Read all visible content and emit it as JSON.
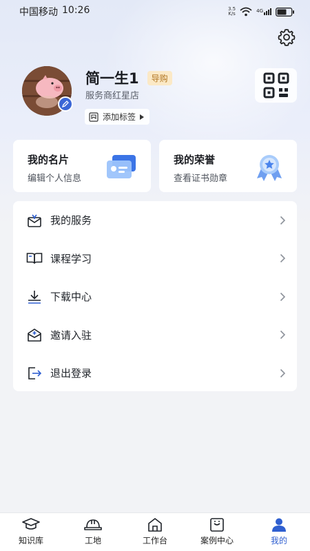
{
  "status_bar": {
    "carrier": "中国移动",
    "time": "10:26",
    "network_speed": "3.5",
    "speed_unit": "K/s",
    "signal_type": "4G"
  },
  "header": {
    "settings_icon": "gear-icon",
    "user_name": "简一生1",
    "role_badge": "导购",
    "store_name": "服务商红星店",
    "add_tag_label": "添加标签",
    "qr_icon": "qr-code-icon"
  },
  "cards": [
    {
      "title": "我的名片",
      "subtitle": "编辑个人信息",
      "icon": "business-card-icon"
    },
    {
      "title": "我的荣誉",
      "subtitle": "查看证书勋章",
      "icon": "medal-icon"
    }
  ],
  "menu": [
    {
      "label": "我的服务",
      "icon": "service-envelope-icon"
    },
    {
      "label": "课程学习",
      "icon": "book-icon"
    },
    {
      "label": "下载中心",
      "icon": "download-icon"
    },
    {
      "label": "邀请入驻",
      "icon": "invite-icon"
    },
    {
      "label": "退出登录",
      "icon": "logout-icon"
    }
  ],
  "tabbar": [
    {
      "label": "知识库",
      "icon": "graduation-cap-icon"
    },
    {
      "label": "工地",
      "icon": "hard-hat-icon"
    },
    {
      "label": "工作台",
      "icon": "home-icon"
    },
    {
      "label": "案例中心",
      "icon": "case-icon"
    },
    {
      "label": "我的",
      "icon": "user-icon",
      "active": true
    }
  ],
  "colors": {
    "accent": "#2f5fd0",
    "badge_bg": "#fbe9c6",
    "badge_text": "#b07420",
    "page_bg": "#f2f3f6"
  }
}
